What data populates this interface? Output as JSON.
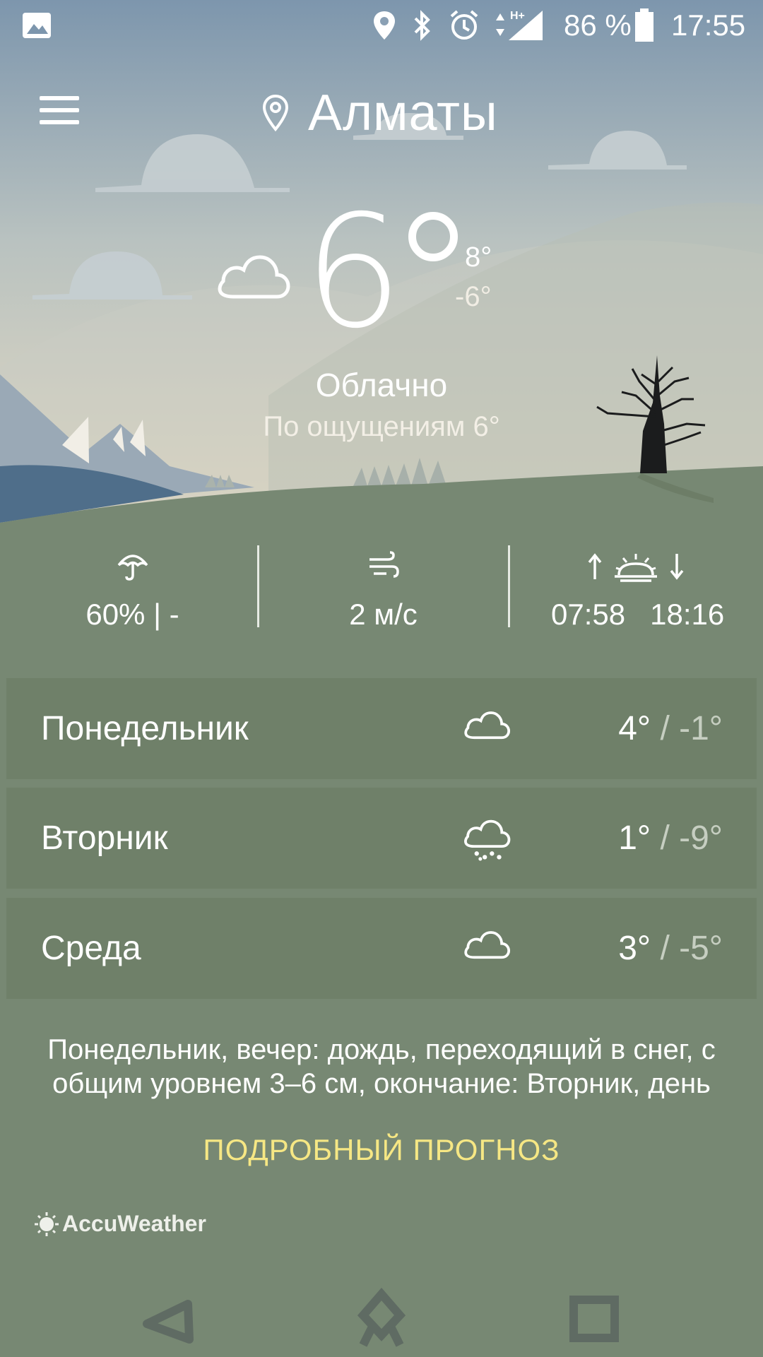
{
  "status_bar": {
    "battery": "86 %",
    "time": "17:55",
    "network": "H+"
  },
  "header": {
    "city": "Алматы"
  },
  "current": {
    "temp": "6",
    "high": "8°",
    "low": "-6°",
    "condition": "Облачно",
    "feels_like": "По ощущениям 6°",
    "icon": "cloud-icon"
  },
  "metrics": {
    "precipitation": "60% | -",
    "wind": "2 м/с",
    "sunrise": "07:58",
    "sunset": "18:16"
  },
  "forecast": [
    {
      "day": "Понедельник",
      "high": "4°",
      "low": "-1°",
      "icon": "cloud-icon"
    },
    {
      "day": "Вторник",
      "high": "1°",
      "low": "-9°",
      "icon": "snow-cloud-icon"
    },
    {
      "day": "Среда",
      "high": "3°",
      "low": "-5°",
      "icon": "cloud-icon"
    }
  ],
  "warning": {
    "line1": "Понедельник, вечер: дождь, переходящий в снег, с",
    "line2": "общим уровнем 3–6 см, окончание: Вторник, день"
  },
  "detail_link": "ПОДРОБНЫЙ ПРОГНОЗ",
  "provider": "AccuWeather",
  "colors": {
    "sky_top": "#7d96ad",
    "sky_bottom": "#e2d9c4",
    "ground": "#778873",
    "row_bg": "#6f8069",
    "accent_link": "#f6e784"
  }
}
